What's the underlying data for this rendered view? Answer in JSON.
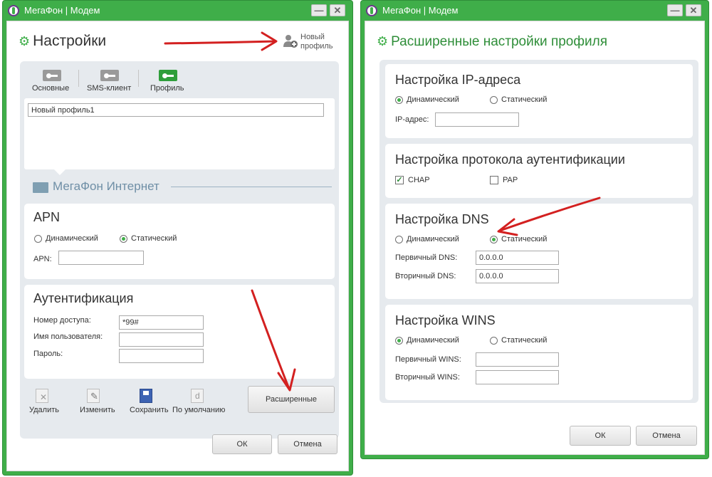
{
  "window_title": "МегаФон | Модем",
  "colors": {
    "accent": "#3fae49",
    "arrow": "#d32020",
    "panel": "#e6eaee"
  },
  "left": {
    "page_title": "Настройки",
    "new_profile": [
      "Новый",
      "профиль"
    ],
    "tabs": [
      "Основные",
      "SMS-клиент",
      "Профиль"
    ],
    "profile_name": "Новый профиль1",
    "section_title": "МегаФон Интернет",
    "apn": {
      "title": "APN",
      "dynamic": "Динамический",
      "static": "Статический",
      "apn_label": "APN:",
      "apn_value": ""
    },
    "auth": {
      "title": "Аутентификация",
      "access_label": "Номер доступа:",
      "access_value": "*99#",
      "user_label": "Имя пользователя:",
      "user_value": "",
      "pass_label": "Пароль:",
      "pass_value": ""
    },
    "toolbar": [
      "Удалить",
      "Изменить",
      "Сохранить",
      "По умолчанию"
    ],
    "advanced_button": "Расширенные",
    "ok": "ОК",
    "cancel": "Отмена"
  },
  "right": {
    "page_title": "Расширенные настройки профиля",
    "ip": {
      "title": "Настройка IP-адреса",
      "dynamic": "Динамический",
      "static": "Статический",
      "ip_label": "IP-адрес:",
      "ip_value": ""
    },
    "auth_proto": {
      "title": "Настройка протокола аутентификации",
      "chap": "CHAP",
      "pap": "PAP",
      "check_mark": "✓"
    },
    "dns": {
      "title": "Настройка DNS",
      "dynamic": "Динамический",
      "static": "Статический",
      "primary_label": "Первичный DNS:",
      "primary_value": "0.0.0.0",
      "secondary_label": "Вторичный DNS:",
      "secondary_value": "0.0.0.0"
    },
    "wins": {
      "title": "Настройка WINS",
      "dynamic": "Динамический",
      "static": "Статический",
      "primary_label": "Первичный WINS:",
      "primary_value": "",
      "secondary_label": "Вторичный WINS:",
      "secondary_value": ""
    },
    "ok": "ОК",
    "cancel": "Отмена"
  }
}
